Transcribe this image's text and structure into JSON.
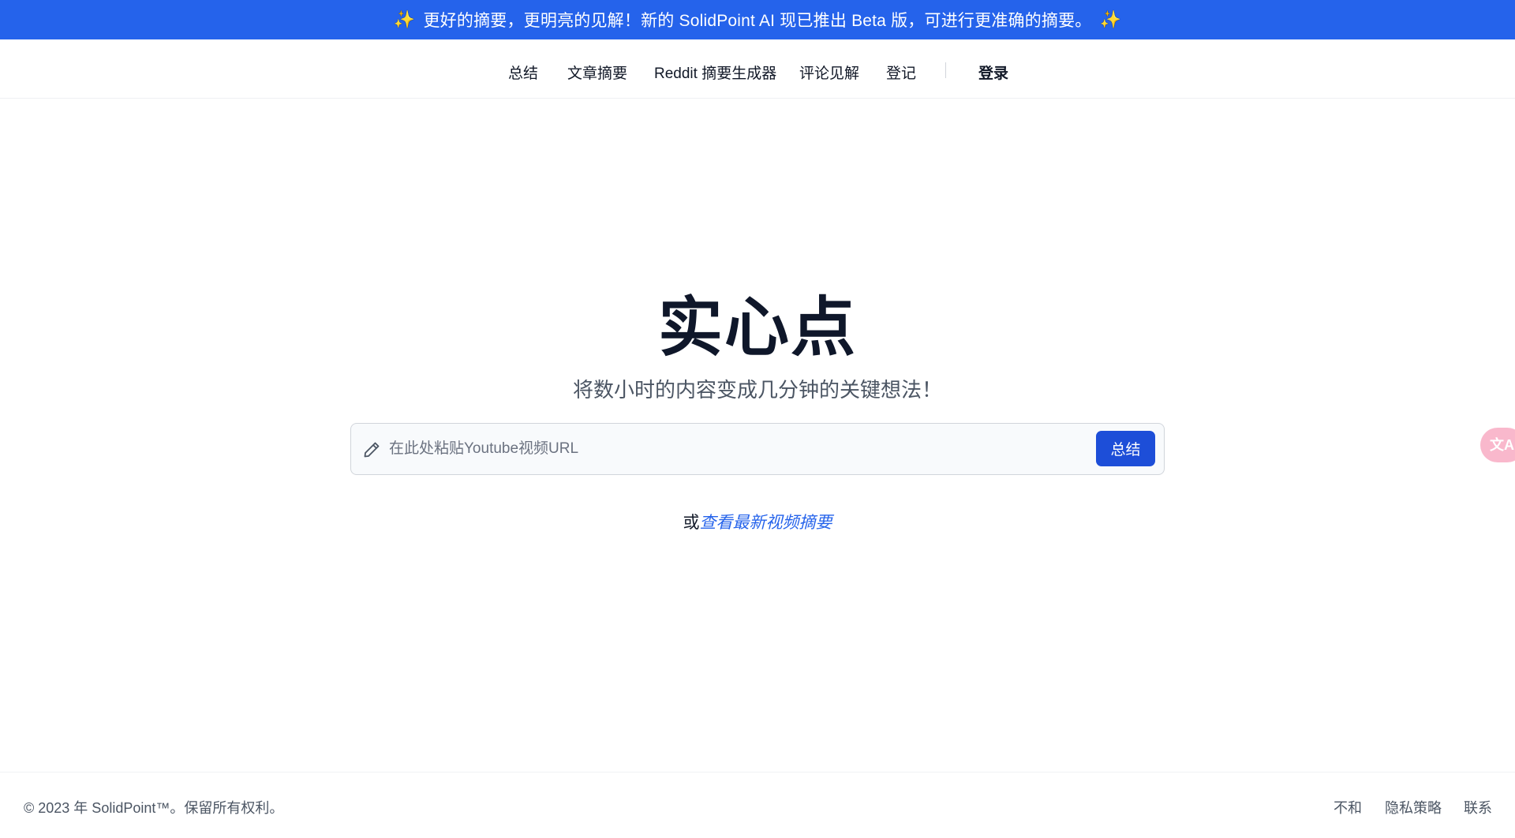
{
  "banner": {
    "sparkle_icon": "sparkles-icon",
    "text": "更好的摘要，更明亮的见解！新的 SolidPoint AI 现已推出 Beta 版，可进行更准确的摘要。"
  },
  "nav": {
    "items": [
      {
        "label": "总结"
      },
      {
        "label": "文章摘要"
      },
      {
        "label": "Reddit 摘要生成器"
      },
      {
        "label": "评论见解"
      },
      {
        "label": "登记"
      }
    ],
    "login_label": "登录"
  },
  "hero": {
    "title": "实心点",
    "subtitle": "将数小时的内容变成几分钟的关键想法！"
  },
  "search": {
    "placeholder": "在此处粘贴Youtube视频URL",
    "value": "",
    "button_label": "总结",
    "icon": "pencil-icon"
  },
  "or_line": {
    "prefix": "或",
    "link_text": "查看最新视频摘要"
  },
  "translate_widget": {
    "icon": "translate-icon",
    "glyph": "文A"
  },
  "footer": {
    "copyright": "© 2023 年 SolidPoint™。保留所有权利。",
    "links": [
      {
        "label": "不和"
      },
      {
        "label": "隐私策略"
      },
      {
        "label": "联系"
      }
    ]
  },
  "colors": {
    "banner_bg": "#2563eb",
    "button_bg": "#1d4ed8",
    "link": "#2563eb",
    "translate_bg": "#f9b8cc"
  }
}
